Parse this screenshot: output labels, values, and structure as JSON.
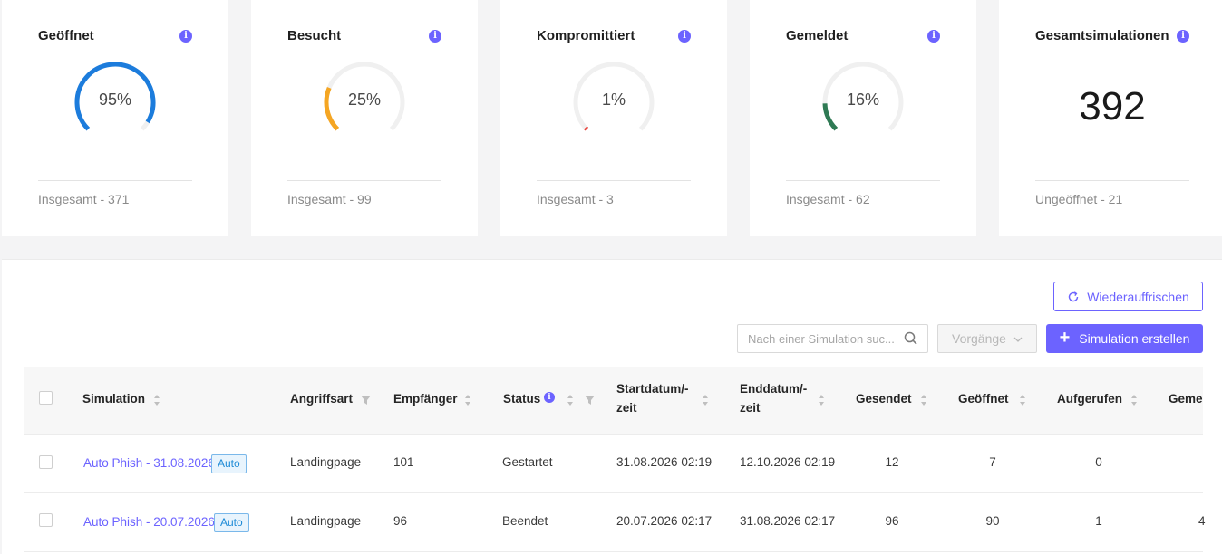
{
  "stats": [
    {
      "title": "Geöffnet",
      "pct": 95,
      "pct_label": "95%",
      "color": "#1c7cdc",
      "footer": "Insgesamt - 371"
    },
    {
      "title": "Besucht",
      "pct": 25,
      "pct_label": "25%",
      "color": "#f5a623",
      "footer": "Insgesamt - 99"
    },
    {
      "title": "Kompromittiert",
      "pct": 1,
      "pct_label": "1%",
      "color": "#e8413a",
      "footer": "Insgesamt - 3"
    },
    {
      "title": "Gemeldet",
      "pct": 16,
      "pct_label": "16%",
      "color": "#2f7a54",
      "footer": "Insgesamt - 62"
    },
    {
      "title": "Gesamtsimulationen",
      "value": "392",
      "footer": "Ungeöffnet - 21"
    }
  ],
  "toolbar": {
    "refresh_label": "Wiederauffrischen",
    "search_placeholder": "Nach einer Simulation suc...",
    "actions_label": "Vorgänge",
    "create_label": "Simulation erstellen"
  },
  "table": {
    "headers": {
      "simulation": "Simulation",
      "attack": "Angriffsart",
      "recipients": "Empfänger",
      "status": "Status",
      "start_1": "Startdatum/-",
      "start_2": "zeit",
      "end_1": "Enddatum/-",
      "end_2": "zeit",
      "sent": "Gesendet",
      "opened": "Geöffnet",
      "visited": "Aufgerufen",
      "reported": "Geme"
    },
    "rows": [
      {
        "name": "Auto Phish - 31.08.2026",
        "tag": "Auto",
        "attack": "Landingpage",
        "recipients": "101",
        "status": "Gestartet",
        "start": "31.08.2026 02:19",
        "end": "12.10.2026 02:19",
        "sent": "12",
        "opened": "7",
        "visited": "0",
        "reported": ""
      },
      {
        "name": "Auto Phish - 20.07.2026",
        "tag": "Auto",
        "attack": "Landingpage",
        "recipients": "96",
        "status": "Beendet",
        "start": "20.07.2026 02:17",
        "end": "31.08.2026 02:17",
        "sent": "96",
        "opened": "90",
        "visited": "1",
        "reported": "4"
      }
    ]
  }
}
